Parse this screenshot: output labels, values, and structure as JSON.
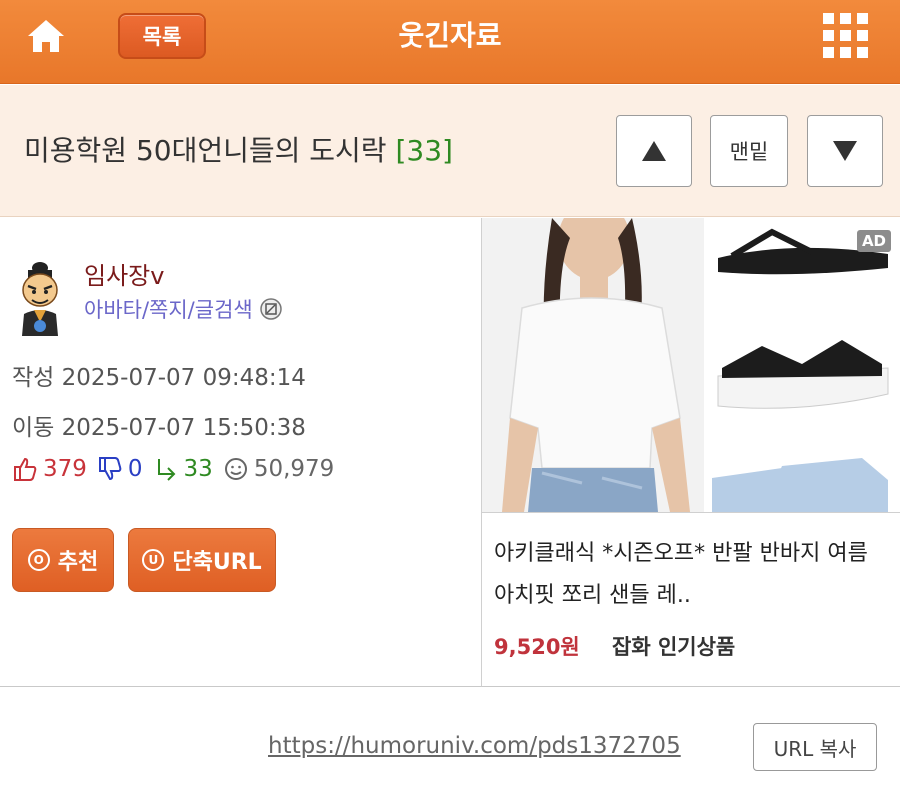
{
  "header": {
    "list_label": "목록",
    "title": "웃긴자료",
    "home_icon": "home-icon",
    "menu_icon": "grid-menu-icon"
  },
  "subject": {
    "title": "미용학원 50대언니들의 도시락",
    "count": "[33]",
    "btn_bottom": "맨밑"
  },
  "author": {
    "name": "임사장v",
    "links": "아바타/쪽지/글검색"
  },
  "meta": {
    "written_label": "작성",
    "written": "2025-07-07 09:48:14",
    "moved_label": "이동",
    "moved": "2025-07-07 15:50:38"
  },
  "stats": {
    "up": "379",
    "down": "0",
    "replies": "33",
    "views": "50,979"
  },
  "actions": {
    "recommend": "추천",
    "recommend_mark": "O",
    "short_url": "단축URL",
    "short_url_mark": "U"
  },
  "ad": {
    "tag": "AD",
    "title": "아키클래식 *시즌오프* 반팔 반바지 여름 아치핏 쪼리 샌들 레..",
    "price": "9,520원",
    "shop": "잡화 인기상품"
  },
  "url": {
    "link": "https://humoruniv.com/pds1372705",
    "copy": "URL 복사"
  },
  "colors": {
    "header_orange": "#ed7f33",
    "subject_bg": "#fcefe4",
    "count_green": "#2f8a22",
    "up_red": "#c8333a",
    "down_blue": "#2a3fc4",
    "author": "#7a1b1b",
    "links": "#6b67c9",
    "price": "#c0333c"
  }
}
